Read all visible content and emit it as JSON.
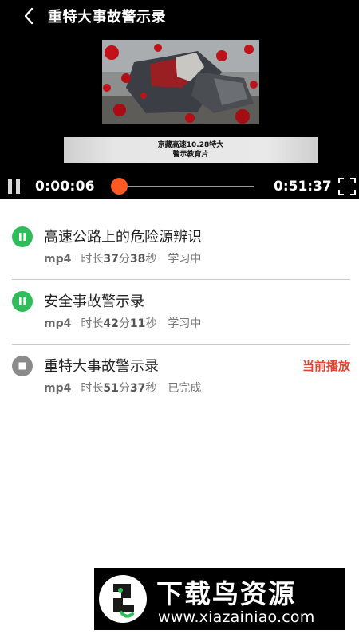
{
  "player": {
    "title": "重特大事故警示录",
    "subtitle_line1": "京藏高速10.28特大",
    "subtitle_line2": "警示教育片",
    "current_time": "0:00:06",
    "total_time": "0:51:37",
    "progress": 0.002,
    "accent_color": "#ff5a23"
  },
  "list": {
    "items": [
      {
        "title": "高速公路上的危险源辨识",
        "format": "mp4",
        "duration_prefix": "时长",
        "duration_min": "37",
        "min_unit": "分",
        "duration_sec": "38",
        "sec_unit": "秒",
        "state": "学习中",
        "icon": "pause-icon",
        "current_label": ""
      },
      {
        "title": "安全事故警示录",
        "format": "mp4",
        "duration_prefix": "时长",
        "duration_min": "42",
        "min_unit": "分",
        "duration_sec": "11",
        "sec_unit": "秒",
        "state": "学习中",
        "icon": "pause-icon",
        "current_label": ""
      },
      {
        "title": "重特大事故警示录",
        "format": "mp4",
        "duration_prefix": "时长",
        "duration_min": "51",
        "min_unit": "分",
        "duration_sec": "37",
        "sec_unit": "秒",
        "state": "已完成",
        "icon": "stop-icon",
        "current_label": "当前播放"
      }
    ]
  },
  "watermark": {
    "title": "下载鸟资源",
    "url": "www.xiazainiao.com"
  },
  "colors": {
    "playing_green": "#2ebd5a",
    "stopped_gray": "#8b8b8b",
    "current_red": "#e8412f"
  }
}
